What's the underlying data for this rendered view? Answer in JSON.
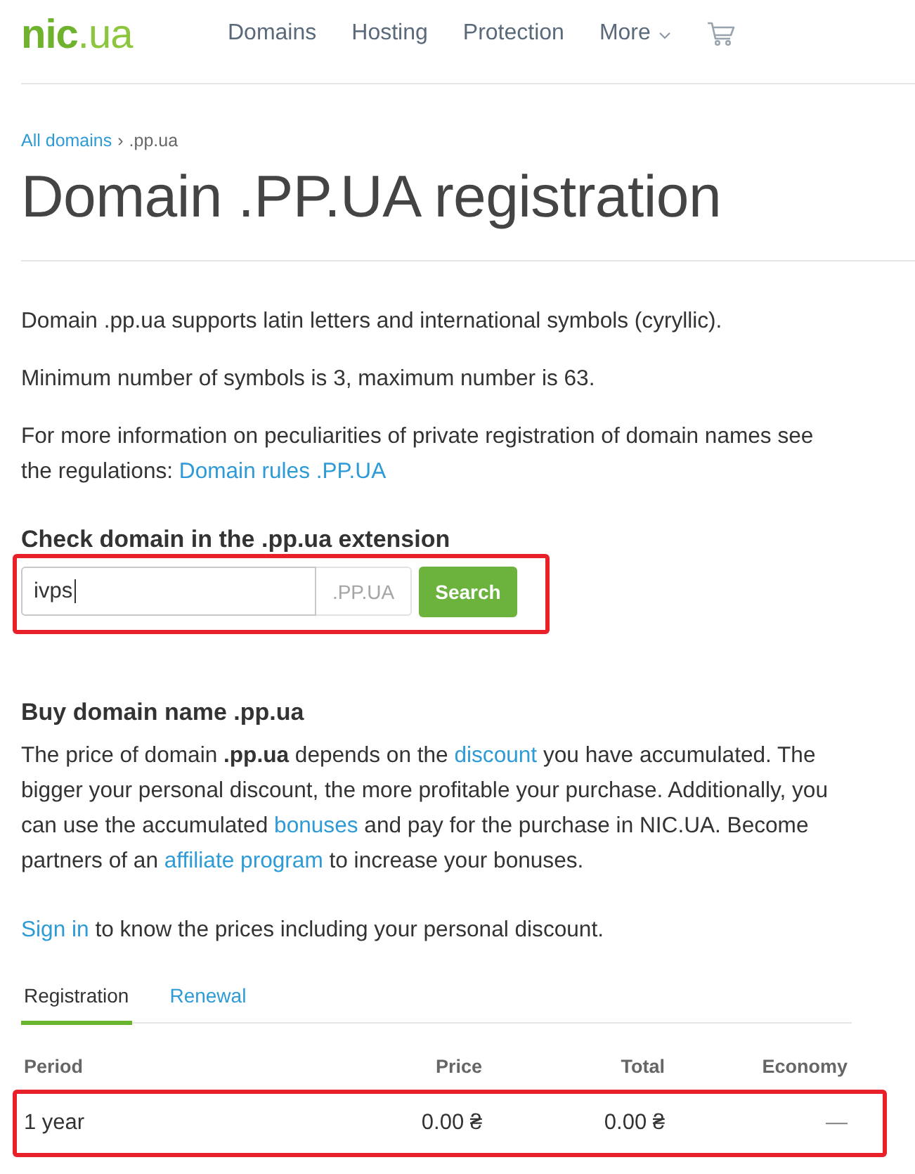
{
  "header": {
    "logo": {
      "name": "nic",
      "suffix": ".ua"
    },
    "nav": [
      {
        "kind": "link",
        "label": "Domains"
      },
      {
        "kind": "link",
        "label": "Hosting"
      },
      {
        "kind": "link",
        "label": "Protection"
      },
      {
        "kind": "dropdown",
        "label": "More"
      }
    ]
  },
  "breadcrumb": {
    "separator": "›",
    "items": [
      {
        "kind": "link",
        "label": "All domains"
      },
      {
        "kind": "current",
        "label": ".pp.ua"
      }
    ]
  },
  "title": "Domain .PP.UA registration",
  "intro": [
    [
      {
        "kind": "text",
        "text": "Domain .pp.ua supports latin letters and international symbols (cyryllic)."
      }
    ],
    [
      {
        "kind": "text",
        "text": "Minimum number of symbols is 3, maximum number is 63."
      }
    ],
    [
      {
        "kind": "text",
        "text": "For more information on peculiarities of private registration of domain names see the regulations: "
      },
      {
        "kind": "link",
        "text": "Domain rules .PP.UA"
      }
    ]
  ],
  "check": {
    "heading": "Check domain in the .pp.ua extension",
    "value": "ivps",
    "focused": true,
    "suffix": ".PP.UA",
    "button": "Search",
    "highlighted": true
  },
  "buy": {
    "heading": "Buy domain name .pp.ua",
    "paragraphs": [
      [
        {
          "kind": "text",
          "text": "The price of domain **.pp.ua** depends on the "
        },
        {
          "kind": "link",
          "text": "discount"
        },
        {
          "kind": "text",
          "text": " you have accumulated. The bigger your personal discount, the more profitable your purchase. Additionally, you can use the accumulated "
        },
        {
          "kind": "link",
          "text": "bonuses"
        },
        {
          "kind": "text",
          "text": " and pay for the purchase in NIC.UA. Become partners of an "
        },
        {
          "kind": "link",
          "text": "affiliate program"
        },
        {
          "kind": "text",
          "text": " to increase your bonuses."
        }
      ],
      [
        {
          "kind": "link",
          "text": "Sign in"
        },
        {
          "kind": "text",
          "text": " to know the prices including your personal discount."
        }
      ]
    ]
  },
  "prices": {
    "tabs": [
      {
        "label": "Registration",
        "selected": true
      },
      {
        "label": "Renewal",
        "selected": false
      }
    ],
    "columns": [
      "Period",
      "Price",
      "Total",
      "Economy"
    ],
    "rows": [
      {
        "cells": [
          "1 year",
          "0.00 ₴",
          "0.00 ₴",
          "—"
        ],
        "highlighted": true
      }
    ]
  }
}
